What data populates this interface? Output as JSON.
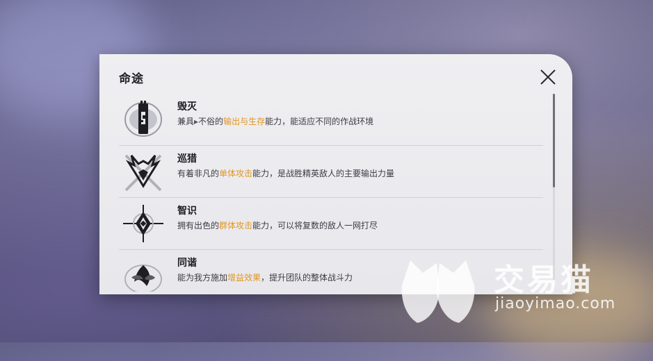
{
  "panel": {
    "title": "命途"
  },
  "paths": [
    {
      "name": "毁灭",
      "desc_prefix": "兼具",
      "desc_partial": "不俗的",
      "highlight": "输出与生存",
      "desc_suffix": "能力，能适应不同的作战环境",
      "icon": "destruction-icon"
    },
    {
      "name": "巡猎",
      "desc_prefix": "有着非凡的",
      "desc_partial": "",
      "highlight": "单体攻击",
      "desc_suffix": "能力，是战胜精英敌人的主要输出力量",
      "icon": "the-hunt-icon"
    },
    {
      "name": "智识",
      "desc_prefix": "拥有出色的",
      "desc_partial": "",
      "highlight": "群体攻击",
      "desc_suffix": "能力，可以将复数的敌人一网打尽",
      "icon": "erudition-icon"
    },
    {
      "name": "同谐",
      "desc_prefix": "能为我方施加",
      "desc_partial": "",
      "highlight": "增益效果",
      "desc_suffix": "，提升团队的整体战斗力",
      "icon": "harmony-icon"
    }
  ],
  "watermark": {
    "text": "交易猫",
    "url": "jiaoyimao.com"
  },
  "colors": {
    "highlight": "#e39520",
    "panel_bg": "#efeff2"
  }
}
